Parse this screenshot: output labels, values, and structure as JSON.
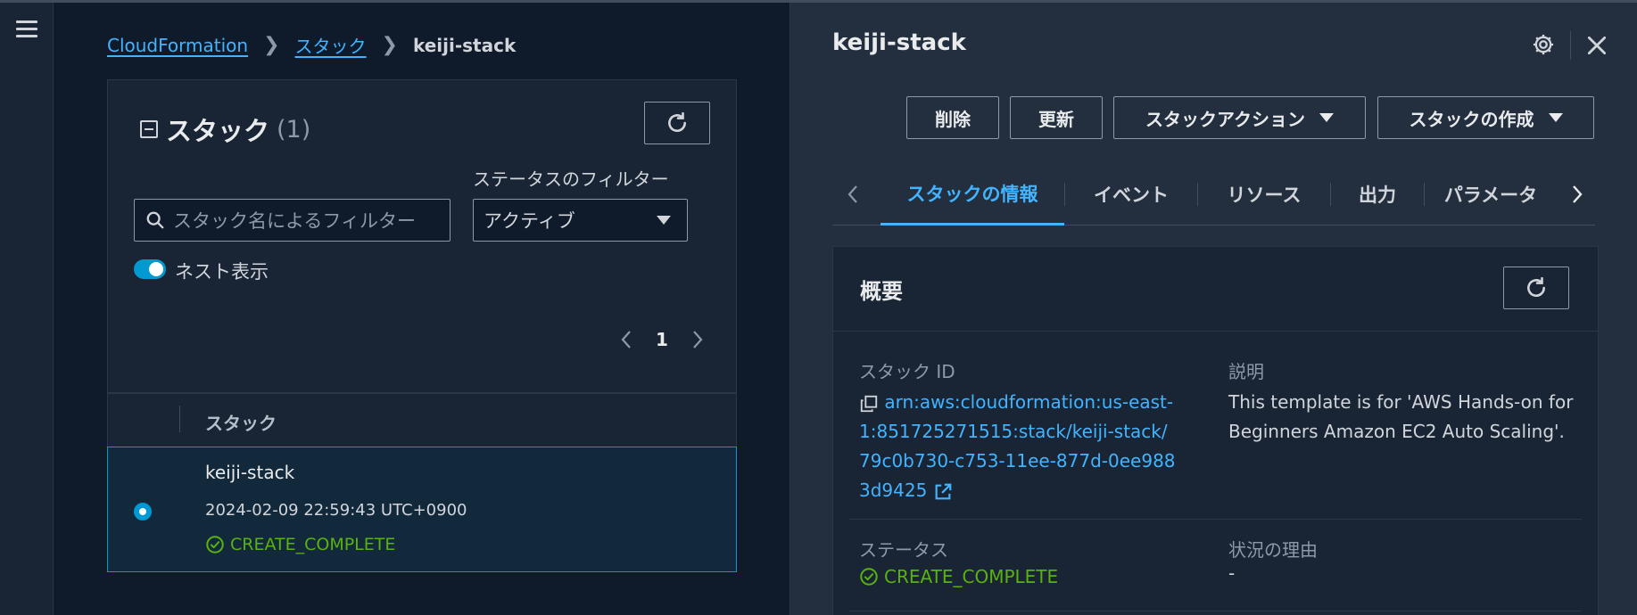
{
  "breadcrumb": {
    "item1": "CloudFormation",
    "item2": "スタック",
    "current": "keiji-stack"
  },
  "stacks_panel": {
    "title": "スタック",
    "count": "(1)",
    "filter_label": "ステータスのフィルター",
    "search_placeholder": "スタック名によるフィルター",
    "status_filter_value": "アクティブ",
    "nested_toggle_label": "ネスト表示",
    "nested_toggle_on": true,
    "page_number": "1",
    "column_header": "スタック"
  },
  "stack_row": {
    "name": "keiji-stack",
    "created": "2024-02-09 22:59:43 UTC+0900",
    "status": "CREATE_COMPLETE",
    "selected": true
  },
  "detail": {
    "title": "keiji-stack",
    "buttons": {
      "delete": "削除",
      "update": "更新",
      "stack_actions": "スタックアクション",
      "create_stack": "スタックの作成"
    },
    "tabs": [
      "スタックの情報",
      "イベント",
      "リソース",
      "出力",
      "パラメータ"
    ],
    "active_tab": 0,
    "overview": {
      "title": "概要",
      "stack_id_label": "スタック ID",
      "stack_id_value": "arn:aws:cloudformation:us-east-1:851725271515:stack/keiji-stack/79c0b730-c753-11ee-877d-0ee9883d9425",
      "description_label": "説明",
      "description_value": "This template is for 'AWS Hands-on for Beginners Amazon EC2 Auto Scaling'.",
      "status_label": "ステータス",
      "status_value": "CREATE_COMPLETE",
      "reason_label": "状況の理由",
      "reason_value": "-"
    }
  },
  "colors": {
    "link": "#42b4ff",
    "success": "#59b210",
    "accent": "#0099d1"
  }
}
